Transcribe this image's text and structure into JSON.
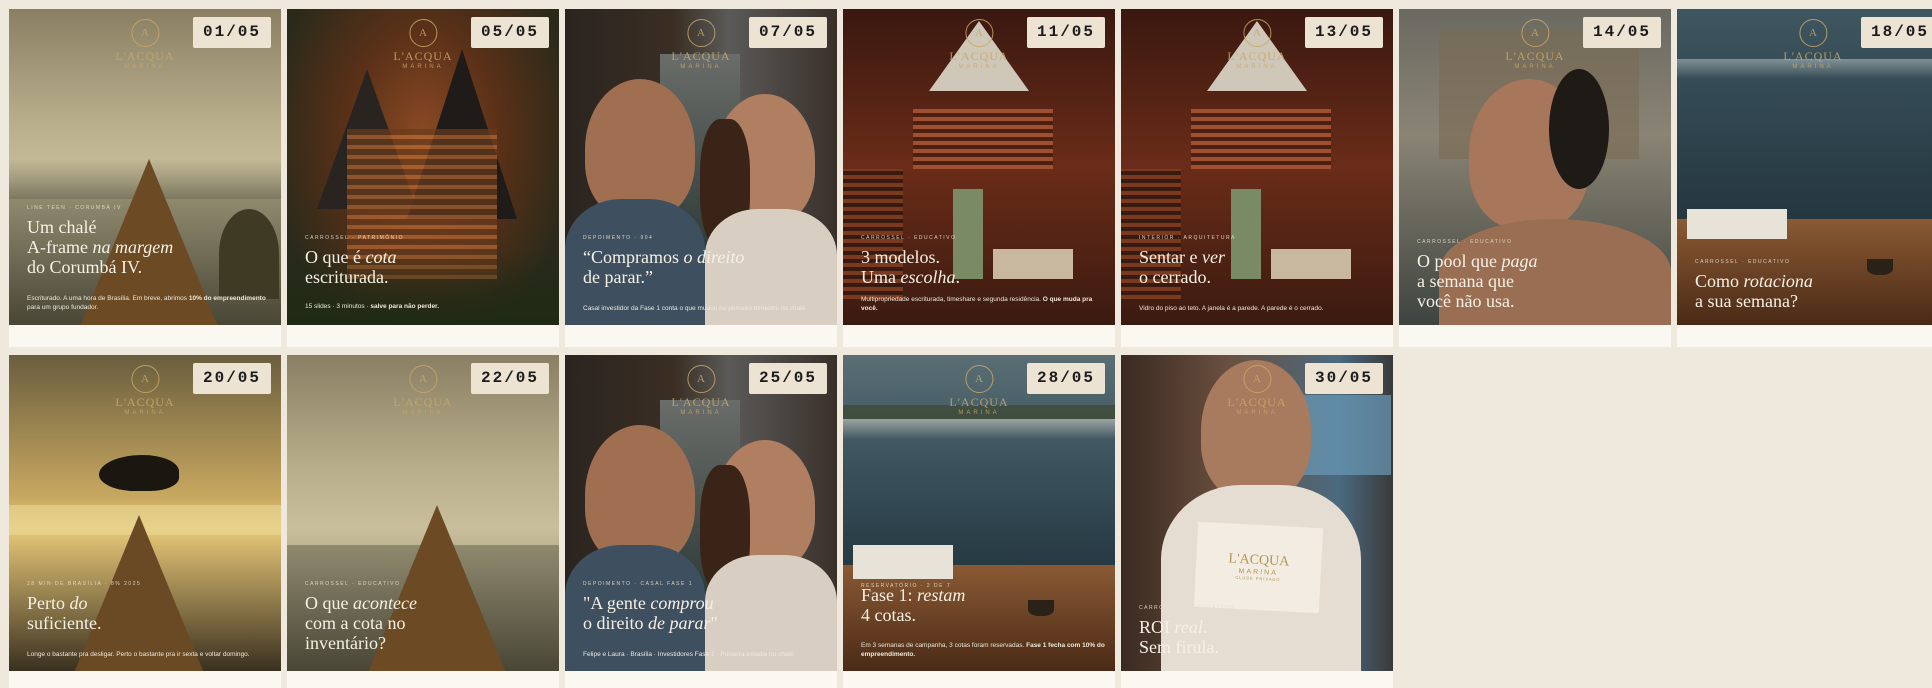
{
  "posts": [
    {
      "date": "01/05",
      "kicker": "LINE TEEN · CORUMBÁ IV",
      "headline": [
        "Um chalé",
        "A-frame ",
        "na margem",
        "do Corumbá IV."
      ],
      "caption_pre": "Escriturado. A uma hora de Brasília. Em breve, abrimos ",
      "caption_bold": "10% do empreendimento",
      "caption_post": " para um grupo fundador."
    },
    {
      "date": "05/05",
      "kicker": "CARROSSEL · PATRIMÔNIO",
      "headline": [
        "O que é ",
        "cota",
        "escriturada."
      ],
      "caption_pre": "15 slides · 3 minutos · ",
      "caption_bold": "salve para não perder.",
      "caption_post": ""
    },
    {
      "date": "07/05",
      "kicker": "DEPOIMENTO · 904",
      "headline": [
        "“Compramos ",
        "o direito",
        "de parar.”"
      ],
      "caption_pre": "Casal investidor da Fase 1 conta o que mudou no primeiro trimestre no chalé.",
      "caption_bold": "",
      "caption_post": ""
    },
    {
      "date": "11/05",
      "kicker": "CARROSSEL · EDUCATIVO",
      "headline": [
        "3 modelos.",
        "Uma ",
        "escolha",
        "."
      ],
      "caption_pre": "Multipropriedade escriturada, timeshare e segunda residência. ",
      "caption_bold": "O que muda pra você.",
      "caption_post": ""
    },
    {
      "date": "13/05",
      "kicker": "INTERIOR · ARQUITETURA",
      "headline": [
        "Sentar e ",
        "ver",
        "o cerrado."
      ],
      "caption_pre": "Vidro do piso ao teto. A janela é a parede. A parede é o cerrado.",
      "caption_bold": "",
      "caption_post": ""
    },
    {
      "date": "14/05",
      "kicker": "CARROSSEL · EDUCATIVO",
      "headline": [
        "O pool que ",
        "paga",
        "a semana que",
        "você não usa."
      ],
      "caption_pre": "",
      "caption_bold": "",
      "caption_post": ""
    },
    {
      "date": "18/05",
      "kicker": "CARROSSEL · EDUCATIVO",
      "headline": [
        "Como ",
        "rotaciona",
        "a sua semana?"
      ],
      "caption_pre": "",
      "caption_bold": "",
      "caption_post": ""
    },
    {
      "date": "20/05",
      "kicker": "28 MIN DE BRASÍLIA · 8% 2025",
      "headline": [
        "Perto ",
        "do",
        "suficiente."
      ],
      "caption_pre": "Longe o bastante pra desligar. Perto o bastante pra ir sexta e voltar domingo.",
      "caption_bold": "",
      "caption_post": ""
    },
    {
      "date": "22/05",
      "kicker": "CARROSSEL · EDUCATIVO",
      "headline": [
        "O que ",
        "acontece",
        "com a cota no",
        "inventário?"
      ],
      "caption_pre": "",
      "caption_bold": "",
      "caption_post": ""
    },
    {
      "date": "25/05",
      "kicker": "DEPOIMENTO · CASAL FASE 1",
      "headline": [
        "\"A gente ",
        "comprou",
        "o direito ",
        "de parar",
        "\""
      ],
      "caption_pre": "Felipe e Laura · Brasília · Investidores Fase 1 · Primeira estadia no chalé.",
      "caption_bold": "",
      "caption_post": ""
    },
    {
      "date": "28/05",
      "kicker": "RESERVATÓRIO · 2 DE 7",
      "headline": [
        "Fase 1: ",
        "restam",
        "4 cotas."
      ],
      "caption_pre": "Em 3 semanas de campanha, 3 cotas foram reservadas. ",
      "caption_bold": "Fase 1 fecha com 10% do empreendimento.",
      "caption_post": ""
    },
    {
      "date": "30/05",
      "kicker": "CARROSSEL · EDUCATIVO",
      "headline": [
        "ROI ",
        "real",
        "Sem firula."
      ],
      "caption_pre": "",
      "caption_bold": "",
      "caption_post": ""
    }
  ],
  "brand": {
    "name": "L'ACQUA",
    "sub": "MARINA",
    "card_name": "L'ACQUA",
    "card_sub": "MARINA",
    "card_tag": "CLUBE PRIVADO"
  },
  "colors": {
    "background": "#efe8dc",
    "badge": "#ece3d3",
    "gold": "#c8a868"
  }
}
